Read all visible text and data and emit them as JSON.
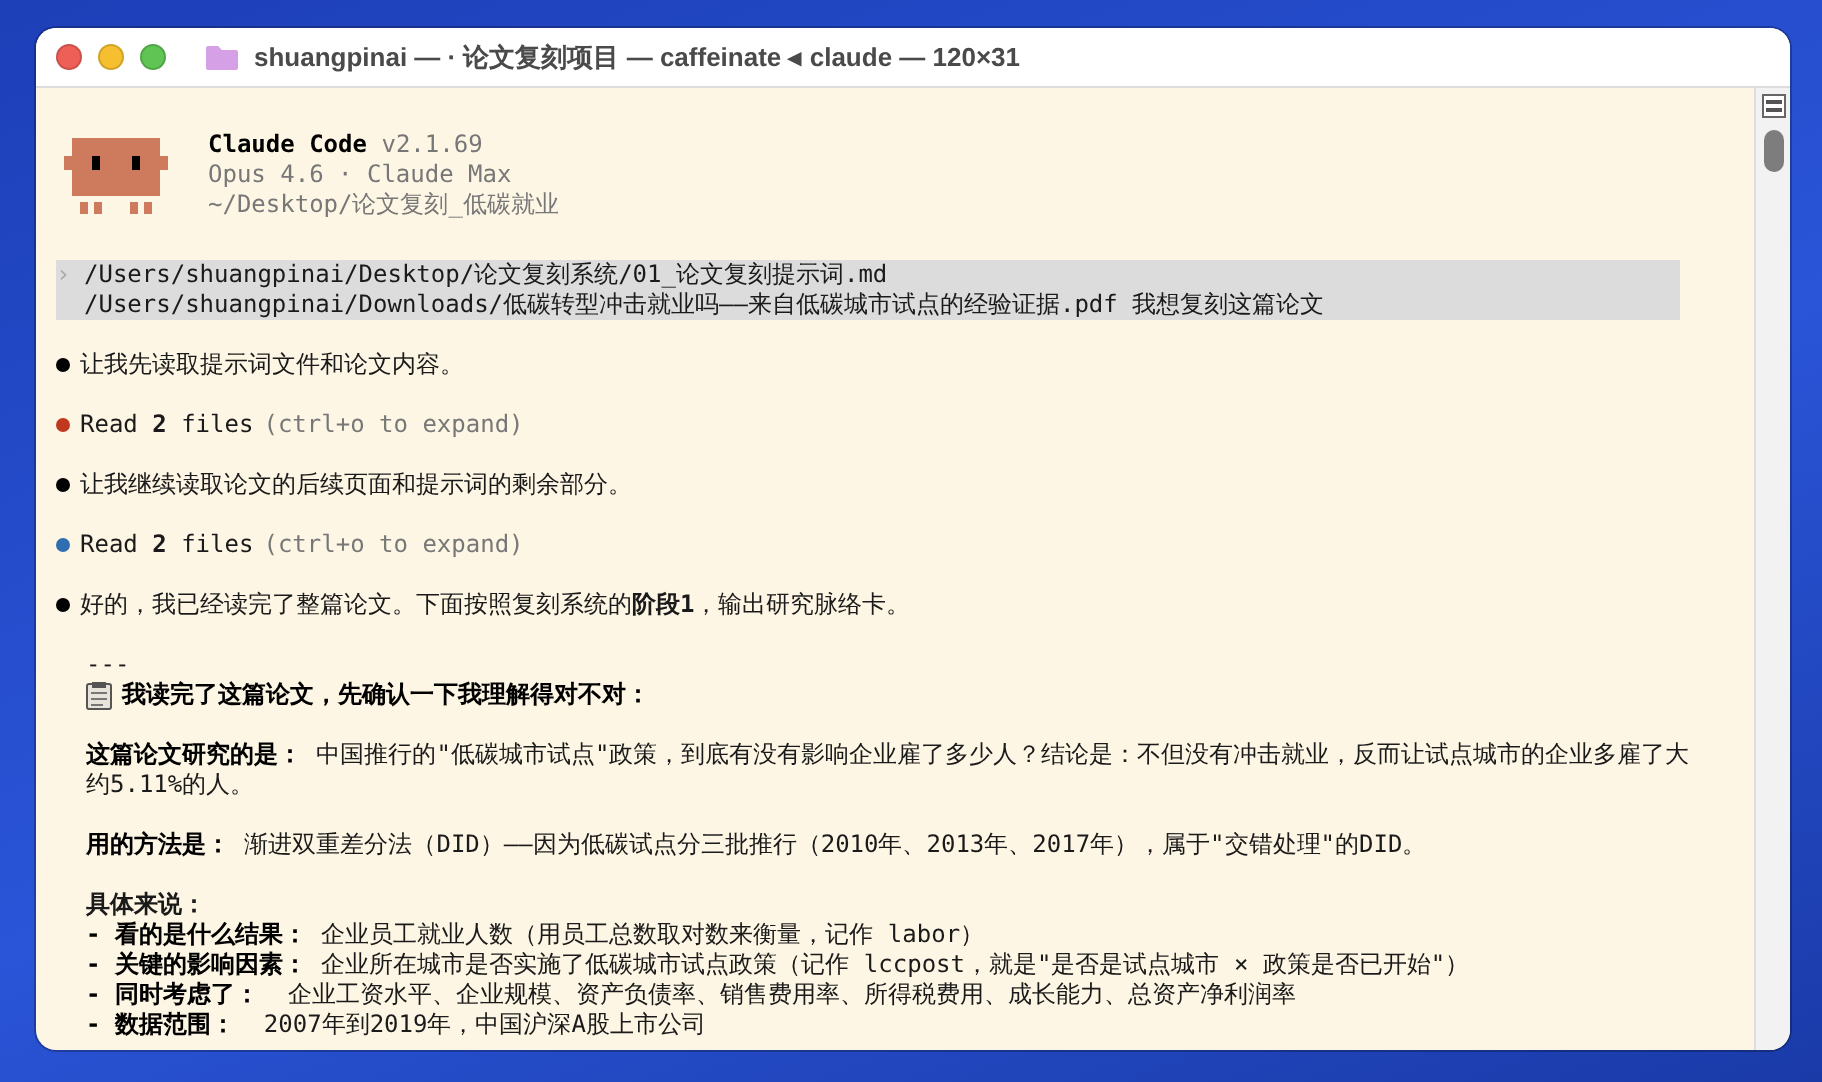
{
  "window": {
    "title": "shuangpinai — ·  论文复刻项目 — caffeinate ◂ claude — 120×31"
  },
  "header": {
    "product": "Claude Code",
    "version": "v2.1.69",
    "plan": "Opus 4.6 · Claude Max",
    "path": "~/Desktop/论文复刻_低碳就业"
  },
  "prompt": {
    "symbol": "›",
    "lines": [
      "/Users/shuangpinai/Desktop/论文复刻系统/01_论文复刻提示词.md",
      "/Users/shuangpinai/Downloads/低碳转型冲击就业吗——来自低碳城市试点的经验证据.pdf 我想复刻这篇论文"
    ]
  },
  "messages": [
    {
      "kind": "text",
      "color": "#000000",
      "text": "让我先读取提示词文件和论文内容。"
    },
    {
      "kind": "tool",
      "color": "#c0391f",
      "text": "Read **2** files",
      "hint": "(ctrl+o to expand)"
    },
    {
      "kind": "text",
      "color": "#000000",
      "text": "让我继续读取论文的后续页面和提示词的剩余部分。"
    },
    {
      "kind": "tool",
      "color": "#2f6fb0",
      "text": "Read **2** files",
      "hint": "(ctrl+o to expand)"
    },
    {
      "kind": "text",
      "color": "#000000",
      "text": "好的，我已经读完了整篇论文。下面按照复刻系统的**阶段1**，输出研究脉络卡。"
    }
  ],
  "response": {
    "rule": "---",
    "heading": "我读完了这篇论文，先确认一下我理解得对不对：",
    "paragraphs": [
      {
        "label": "这篇论文研究的是：",
        "text": " 中国推行的\"低碳城市试点\"政策，到底有没有影响企业雇了多少人？结论是：不但没有冲击就业，反而让试点城市的企业多雇了大约5.11%的人。"
      },
      {
        "label": "用的方法是：",
        "text": " 渐进双重差分法（DID）——因为低碳试点分三批推行（2010年、2013年、2017年），属于\"交错处理\"的DID。"
      }
    ],
    "details_title": "具体来说：",
    "details": [
      {
        "bullet": "-",
        "label": "看的是什么结果：",
        "text": " 企业员工就业人数（用员工总数取对数来衡量，记作 labor）"
      },
      {
        "bullet": "-",
        "label": "关键的影响因素：",
        "text": " 企业所在城市是否实施了低碳城市试点政策（记作 lccpost，就是\"是否是试点城市 × 政策是否已开始\"）"
      },
      {
        "bullet": "-",
        "label": "同时考虑了：",
        "text": "  企业工资水平、企业规模、资产负债率、销售费用率、所得税费用、成长能力、总资产净利润率"
      },
      {
        "bullet": "-",
        "label": "数据范围：",
        "text": "  2007年到2019年，中国沪深A股上市公司"
      }
    ]
  }
}
